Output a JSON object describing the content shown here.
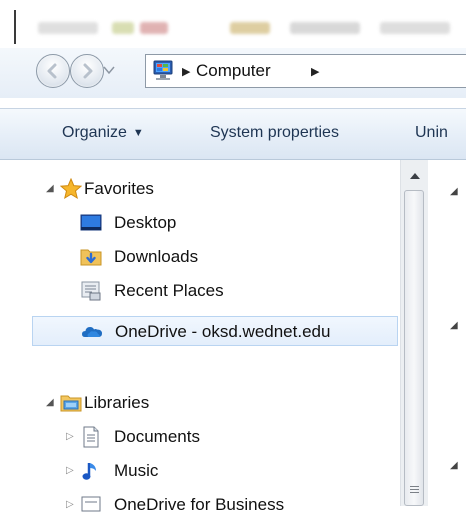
{
  "address": {
    "location": "Computer"
  },
  "toolbar": {
    "organize": "Organize",
    "system_properties": "System properties",
    "uninstall": "Unin"
  },
  "tree": {
    "favorites": "Favorites",
    "desktop": "Desktop",
    "downloads": "Downloads",
    "recent_places": "Recent Places",
    "onedrive": "OneDrive - oksd.wednet.edu",
    "libraries": "Libraries",
    "documents": "Documents",
    "music": "Music",
    "onedrive_business": "OneDrive for Business"
  },
  "colors": {
    "accent": "#2b6cb8",
    "selection_bg": "#e3eefb",
    "command_text": "#1e3553"
  }
}
